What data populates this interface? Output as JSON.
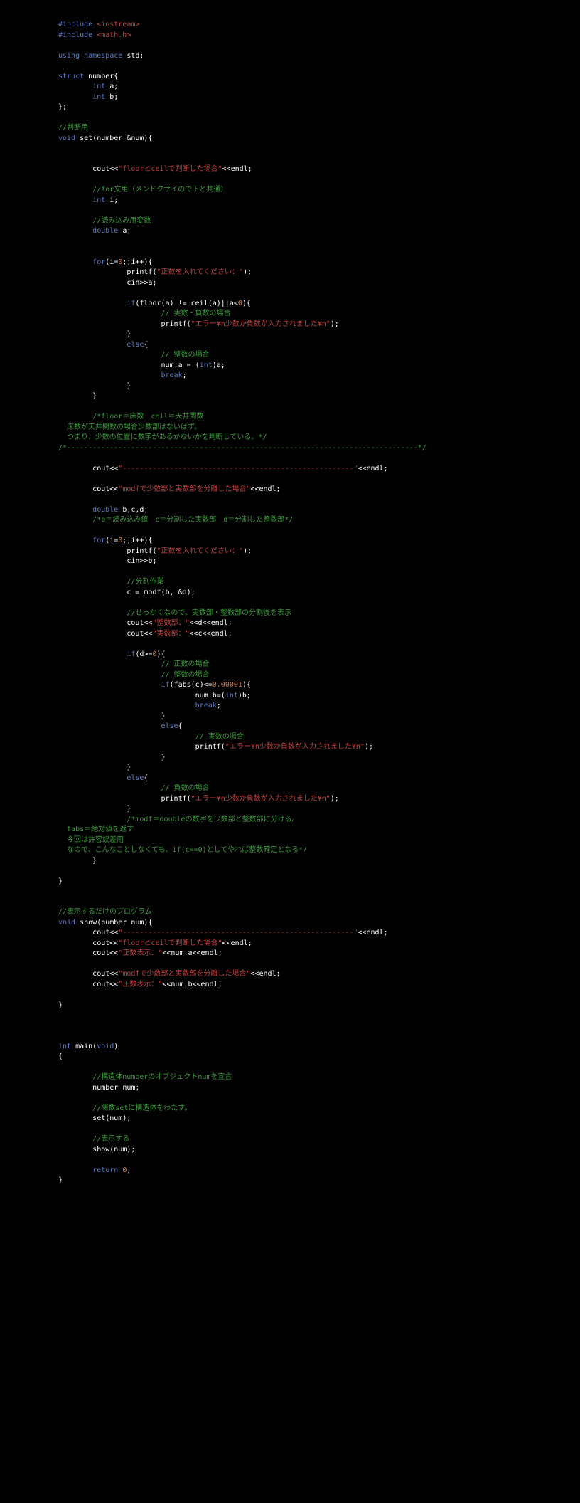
{
  "preproc": {
    "include1": "#include ",
    "include1_file": "<iostream>",
    "include2": "#include ",
    "include2_file": "<math.h>"
  },
  "using_ns": {
    "kw": "using namespace ",
    "ident": "std;"
  },
  "struct_def": {
    "kw_struct": "struct",
    "name": " number{",
    "kw_int1": "int",
    "var_a": " a;",
    "kw_int2": "int",
    "var_b": " b;",
    "close": "};"
  },
  "comment_hanbetsu": "//判断用",
  "set_func": {
    "kw_void": "void",
    "name": " set(number &num){"
  },
  "cout_floor_ceil": {
    "pre": "cout<<",
    "str": "\"floorとceilで判断した場合\"",
    "post": "<<endl;"
  },
  "comment_for": "//for文用（メンドクサイので下と共通）",
  "int_i": {
    "kw": "int",
    "var": " i;"
  },
  "comment_yomi": "//読み込み用変数",
  "double_a": {
    "kw": "double",
    "var": " a;"
  },
  "for1": {
    "kw_for": "for",
    "cond": "(i=",
    "zero": "0",
    "cond2": ";;i++){",
    "printf": "printf(",
    "printf_str": "\"正数を入れてください：\"",
    "printf_end": ");",
    "cin": "cin>>a;"
  },
  "if_floor": {
    "kw_if": "if",
    "cond": "(floor(a) != ceil(a)||a<",
    "zero": "0",
    "cond_end": "){",
    "comment": "// 実数・負数の場合",
    "printf": "printf(",
    "printf_str": "\"エラー¥n少数か負数が入力されました¥n\"",
    "printf_end": ");",
    "close": "}",
    "kw_else": "else",
    "else_open": "{",
    "comment_else": "// 整数の場合",
    "num_a": "num.a = (",
    "kw_int": "int",
    "num_a_end": ")a;",
    "kw_break": "break",
    "break_end": ";",
    "else_close": "}"
  },
  "for1_close": "}",
  "comment_floor": "/*floor＝床数　ceil＝天井関数\n  床数が天井関数の場合少数部はないはず。\n  つまり、少数の位置に数字があるかないかを判断している。*/",
  "sep_comment": "/*----------------------------------------------------------------------------------*/",
  "cout_sep": {
    "pre": "cout<<",
    "str": "\"------------------------------------------------------\"",
    "post": "<<endl;"
  },
  "cout_modf_title": {
    "pre": "cout<<",
    "str": "\"modfで少数部と実数部を分離した場合\"",
    "post": "<<endl;"
  },
  "double_bcd": {
    "kw": "double",
    "var": " b,c,d;"
  },
  "comment_bcd": "/*b＝読み込み値　c＝分割した実数部　d＝分割した整数部*/",
  "for2": {
    "kw_for": "for",
    "cond": "(i=",
    "zero": "0",
    "cond2": ";;i++){",
    "printf": "printf(",
    "printf_str": "\"正数を入れてください：\"",
    "printf_end": ");",
    "cin": "cin>>b;"
  },
  "comment_bunkatsu": "//分割作業",
  "modf_line": "c = modf(b, &d);",
  "comment_sekkaku": "//せっかくなので、実数部・整数部の分割後を表示",
  "cout_seisu": {
    "pre": "cout<<",
    "str": "\"整数部：\"",
    "post": "<<d<<endl;"
  },
  "cout_jissu": {
    "pre": "cout<<",
    "str": "\"実数部：\"",
    "post": "<<c<<endl;"
  },
  "if_d": {
    "kw_if": "if",
    "cond": "(d>=",
    "zero": "0",
    "cond_end": "){",
    "comment1": "// 正数の場合",
    "comment2": "// 整数の場合",
    "kw_if2": "if",
    "fabs_cond": "(fabs(c)<=",
    "fabs_num": "0.00001",
    "fabs_end": "){",
    "num_b": "num.b=(",
    "kw_int": "int",
    "num_b_end": ")b;",
    "kw_break": "break",
    "break_end": ";",
    "close1": "}",
    "kw_else": "else",
    "else_open": "{",
    "comment_jissu": "// 実数の場合",
    "printf": "printf(",
    "printf_str": "\"エラー¥n少数か負数が入力されました¥n\"",
    "printf_end": ");",
    "else_close": "}",
    "outer_close": "}",
    "kw_else2": "else",
    "else2_open": "{",
    "comment_fusu": "// 負数の場合",
    "printf2": "printf(",
    "printf2_str": "\"エラー¥n少数か負数が入力されました¥n\"",
    "printf2_end": ");",
    "else2_close": "}"
  },
  "comment_modf": "/*modf＝doubleの数字を少数部と整数部に分ける。\n  fabs＝絶対値を返す\n  今回は許容誤差用\n  なので、こんなことしなくても、if(c==0)としてやれば整数確定となる*/",
  "for2_close": "}",
  "set_close": "}",
  "comment_hyoji": "//表示するだけのプログラム",
  "show_func": {
    "kw_void": "void",
    "name": " show(number num){"
  },
  "show_cout_sep": {
    "pre": "cout<<",
    "str": "\"------------------------------------------------------\"",
    "post": "<<endl;"
  },
  "show_cout_floor": {
    "pre": "cout<<",
    "str": "\"floorとceilで判断した場合\"",
    "post": "<<endl;"
  },
  "show_cout_a": {
    "pre": "cout<<",
    "str": "\"正数表示：\"",
    "post": "<<num.a<<endl;"
  },
  "show_cout_modf": {
    "pre": "cout<<",
    "str": "\"modfで少数部と実数部を分離した場合\"",
    "post": "<<endl;"
  },
  "show_cout_b": {
    "pre": "cout<<",
    "str": "\"正数表示：\"",
    "post": "<<num.b<<endl;"
  },
  "show_close": "}",
  "main_func": {
    "kw_int": "int",
    "name": " main(",
    "kw_void": "void",
    "name_end": ")",
    "open": "{"
  },
  "comment_kouzou": "//構造体numberのオブジェクトnumを宣言",
  "num_decl": "number num;",
  "comment_kansu": "//関数setに構造体をわたす。",
  "set_call": "set(num);",
  "comment_hyoji2": "//表示する",
  "show_call": "show(num);",
  "return_st": {
    "kw": "return",
    "val": " 0",
    "end": ";"
  },
  "main_close": "}"
}
